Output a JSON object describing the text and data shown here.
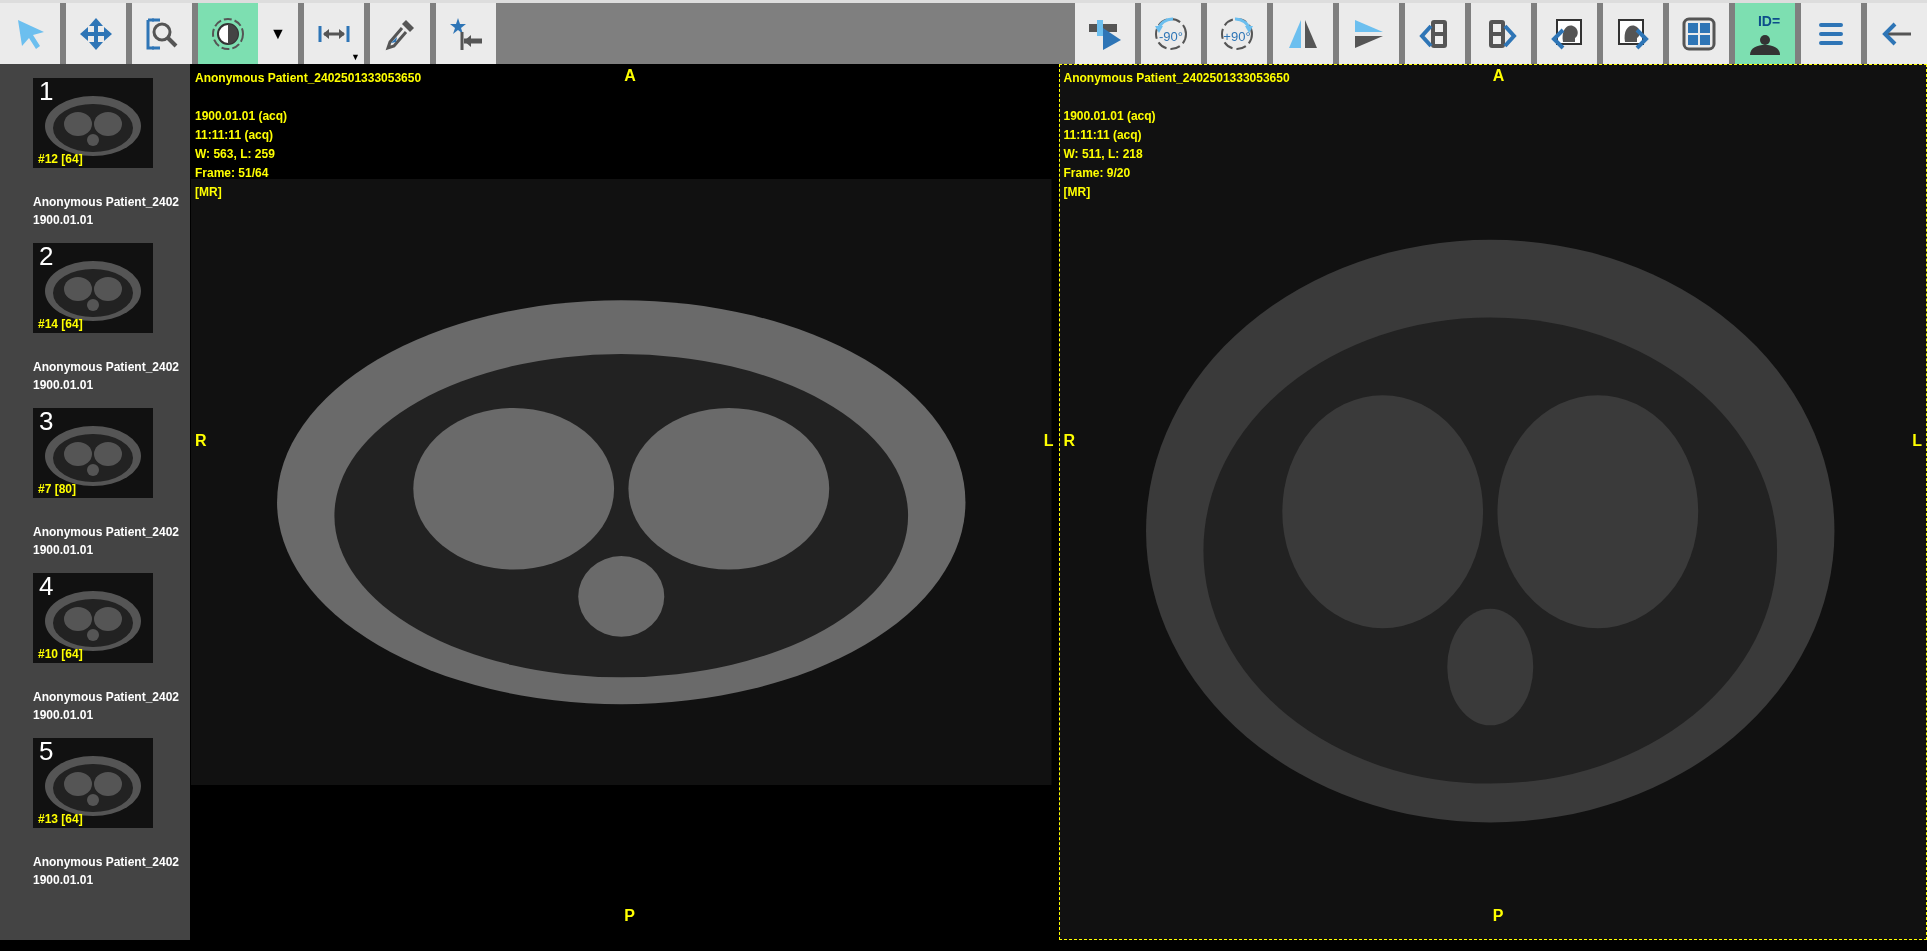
{
  "toolbar": {
    "left_tools": [
      {
        "kind": "pointer",
        "selected": false
      },
      {
        "kind": "pan",
        "selected": false
      },
      {
        "kind": "zoom",
        "selected": false
      },
      {
        "kind": "window-level",
        "selected": true
      },
      {
        "kind": "dropdown",
        "text": "▼",
        "selected": false
      },
      {
        "kind": "measure",
        "caret": "▼",
        "selected": false
      },
      {
        "kind": "eyedropper",
        "selected": false
      },
      {
        "kind": "star-arrow",
        "selected": false
      }
    ],
    "right_tools": [
      {
        "kind": "cine",
        "selected": false
      },
      {
        "kind": "rotate-left",
        "label": "-90°",
        "selected": false
      },
      {
        "kind": "rotate-right",
        "label": "+90°",
        "selected": false
      },
      {
        "kind": "flip-horizontal",
        "selected": false
      },
      {
        "kind": "flip-vertical",
        "selected": false
      },
      {
        "kind": "series-prev",
        "selected": false
      },
      {
        "kind": "series-next",
        "selected": false
      },
      {
        "kind": "study-prev",
        "selected": false
      },
      {
        "kind": "study-next",
        "selected": false
      },
      {
        "kind": "layout",
        "selected": false
      },
      {
        "kind": "patient-info",
        "label": "ID=",
        "selected": true
      },
      {
        "kind": "menu",
        "selected": false
      },
      {
        "kind": "back",
        "selected": false
      }
    ]
  },
  "sidebar": {
    "series": [
      {
        "number": "1",
        "badge": "#12 [64]",
        "patient": "Anonymous Patient_2402",
        "date": "1900.01.01"
      },
      {
        "number": "2",
        "badge": "#14 [64]",
        "patient": "Anonymous Patient_2402",
        "date": "1900.01.01"
      },
      {
        "number": "3",
        "badge": "#7 [80]",
        "patient": "Anonymous Patient_2402",
        "date": "1900.01.01"
      },
      {
        "number": "4",
        "badge": "#10 [64]",
        "patient": "Anonymous Patient_2402",
        "date": "1900.01.01"
      },
      {
        "number": "5",
        "badge": "#13 [64]",
        "patient": "Anonymous Patient_2402",
        "date": "1900.01.01"
      }
    ]
  },
  "viewports": [
    {
      "selected": false,
      "patient": "Anonymous Patient_2402501333053650",
      "lines": [
        "1900.01.01 (acq)",
        "11:11:11 (acq)",
        "W: 563, L: 259",
        "Frame: 51/64",
        "[MR]"
      ],
      "top": "A",
      "left": "R",
      "right": "L",
      "bottom": "P"
    },
    {
      "selected": true,
      "patient": "Anonymous Patient_2402501333053650",
      "lines": [
        "1900.01.01 (acq)",
        "11:11:11 (acq)",
        "W: 511, L: 218",
        "Frame: 9/20",
        "[MR]"
      ],
      "top": "A",
      "left": "R",
      "right": "L",
      "bottom": "P"
    }
  ]
}
